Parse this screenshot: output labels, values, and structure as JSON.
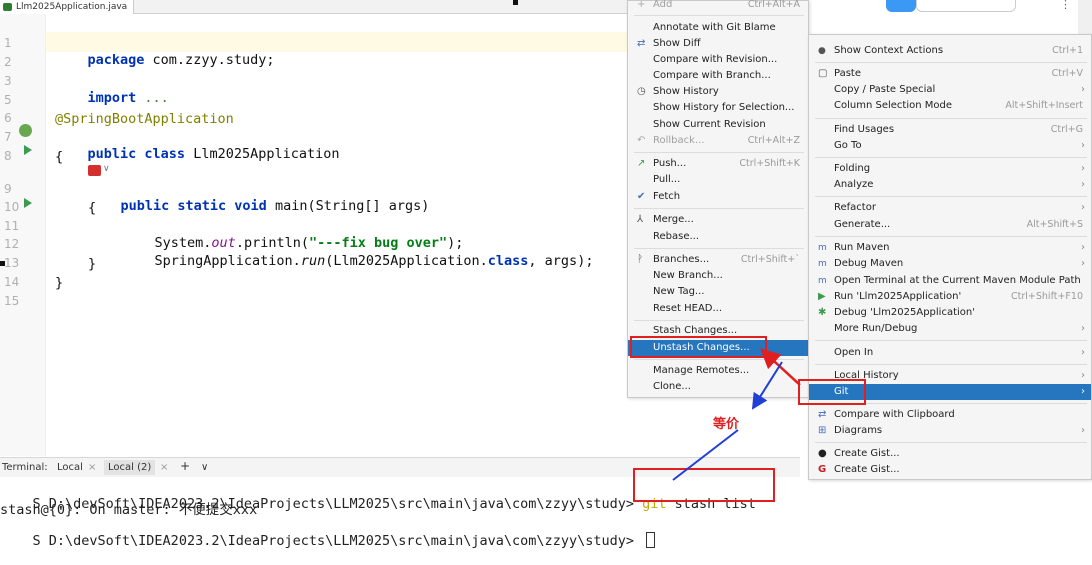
{
  "editor": {
    "tab_title": "Llm2025Application.java",
    "line_numbers": [
      "1",
      "2",
      "3",
      "5",
      "6",
      "7",
      "8",
      "9",
      "10",
      "11",
      "12",
      "13",
      "14",
      "15"
    ],
    "lines": {
      "l1_kw": "package",
      "l1_rest": " com.zzyy.study;",
      "l3_kw": "import",
      "l3_rest": " ...",
      "l6": "@SpringBootApplication",
      "l7_kw": "public class",
      "l7_rest": " Llm2025Application",
      "l8": "{",
      "l9_kw": "public static void",
      "l9_rest": " main(String[] args)",
      "l10": "{",
      "l11_a": "System.",
      "l11_b": "out",
      "l11_c": ".println(",
      "l11_str": "\"---fix bug over\"",
      "l11_d": ");",
      "l12_a": "SpringApplication.",
      "l12_b": "run",
      "l12_c": "(Llm2025Application.",
      "l12_kw": "class",
      "l12_d": ", args);",
      "l13": "}",
      "l14": "}"
    }
  },
  "terminal": {
    "label": "Terminal:",
    "tabs": [
      "Local",
      "Local (2)"
    ],
    "add_label": "+",
    "dropdown_label": "∨",
    "line1_prompt": "S D:\\devSoft\\IDEA2023.2\\IdeaProjects\\LLM2025\\src\\main\\java\\com\\zzyy\\study> ",
    "line1_git": "git",
    "line1_cmd": " stash list",
    "line2": "stash@{0}: On master: 不便提交xxx",
    "line3_prompt": "S D:\\devSoft\\IDEA2023.2\\IdeaProjects\\LLM2025\\src\\main\\java\\com\\zzyy\\study> "
  },
  "git_menu": {
    "items": [
      {
        "label": "Add",
        "shortcut": "Ctrl+Alt+A",
        "disabled": true,
        "icon": "+"
      },
      {
        "label": "Annotate with Git Blame"
      },
      {
        "label": "Show Diff",
        "icon": "⇄"
      },
      {
        "label": "Compare with Revision..."
      },
      {
        "label": "Compare with Branch..."
      },
      {
        "label": "Show History",
        "icon": "◷"
      },
      {
        "label": "Show History for Selection..."
      },
      {
        "label": "Show Current Revision"
      },
      {
        "label": "Rollback...",
        "shortcut": "Ctrl+Alt+Z",
        "disabled": true,
        "icon": "↶"
      },
      {
        "label": "Push...",
        "shortcut": "Ctrl+Shift+K",
        "icon": "↗"
      },
      {
        "label": "Pull..."
      },
      {
        "label": "Fetch",
        "icon": "✔"
      },
      {
        "label": "Merge...",
        "icon": "⅄"
      },
      {
        "label": "Rebase..."
      },
      {
        "label": "Branches...",
        "shortcut": "Ctrl+Shift+`",
        "icon": "ᚹ"
      },
      {
        "label": "New Branch..."
      },
      {
        "label": "New Tag..."
      },
      {
        "label": "Reset HEAD..."
      },
      {
        "label": "Stash Changes..."
      },
      {
        "label": "Unstash Changes..."
      },
      {
        "label": "Manage Remotes..."
      },
      {
        "label": "Clone..."
      }
    ]
  },
  "context_menu": {
    "items": [
      {
        "label": "Show Context Actions",
        "shortcut": "Ctrl+1",
        "icon": "💡"
      },
      {
        "label": "Paste",
        "shortcut": "Ctrl+V",
        "icon": "📋"
      },
      {
        "label": "Copy / Paste Special"
      },
      {
        "label": "Column Selection Mode",
        "shortcut": "Alt+Shift+Insert"
      },
      {
        "label": "Find Usages",
        "shortcut": "Ctrl+G"
      },
      {
        "label": "Go To"
      },
      {
        "label": "Folding"
      },
      {
        "label": "Analyze"
      },
      {
        "label": "Refactor"
      },
      {
        "label": "Generate...",
        "shortcut": "Alt+Shift+S"
      },
      {
        "label": "Run Maven"
      },
      {
        "label": "Debug Maven"
      },
      {
        "label": "Open Terminal at the Current Maven Module Path"
      },
      {
        "label": "Run 'Llm2025Application'",
        "shortcut": "Ctrl+Shift+F10"
      },
      {
        "label": "Debug 'Llm2025Application'"
      },
      {
        "label": "More Run/Debug"
      },
      {
        "label": "Open In"
      },
      {
        "label": "Local History"
      },
      {
        "label": "Git"
      },
      {
        "label": "Compare with Clipboard"
      },
      {
        "label": "Diagrams"
      },
      {
        "label": "Create Gist..."
      },
      {
        "label": "Create Gist..."
      }
    ]
  },
  "annotation": {
    "equivalent_label": "等价"
  },
  "colors": {
    "selection": "#2675bf",
    "annotation_red": "#e02020",
    "keyword": "#0033b3",
    "string": "#067d17"
  }
}
